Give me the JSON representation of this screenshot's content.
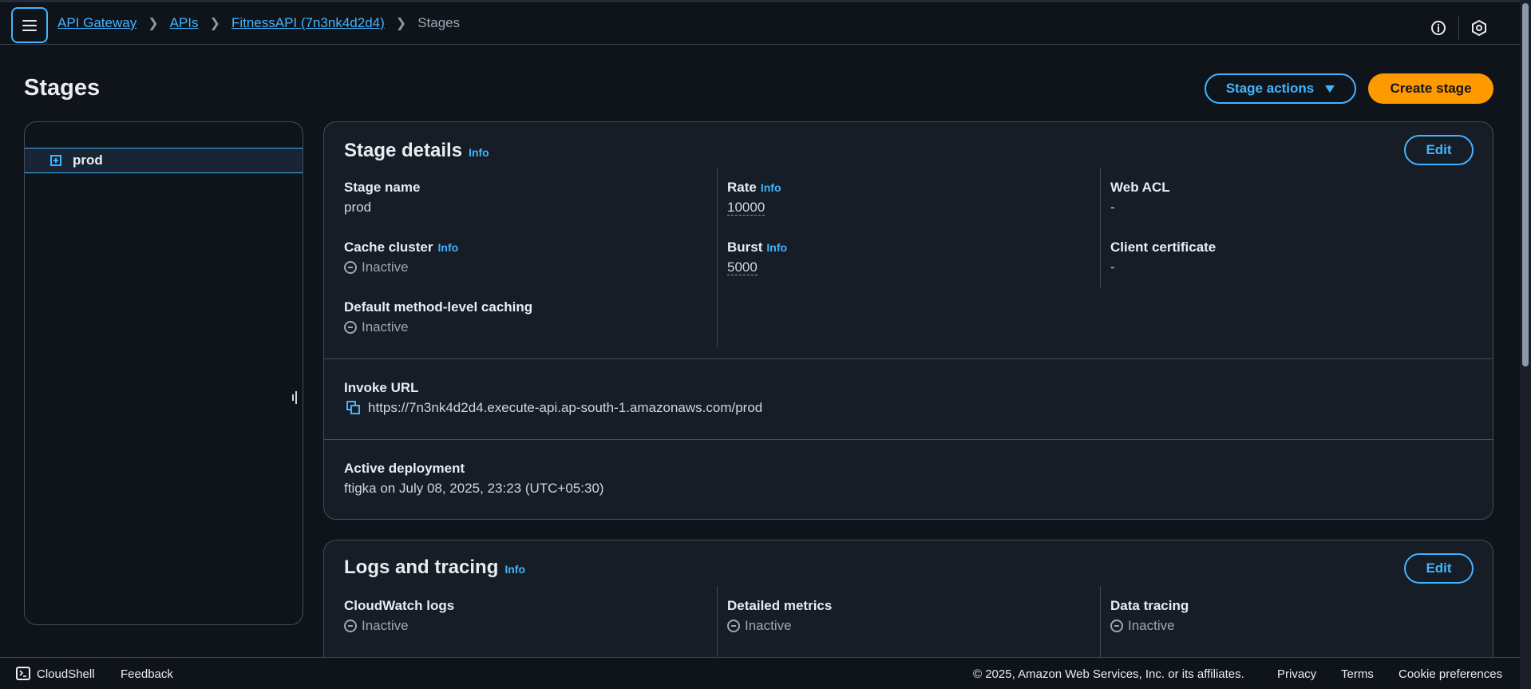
{
  "breadcrumb": {
    "items": [
      "API Gateway",
      "APIs",
      "FitnessAPI (7n3nk4d2d4)"
    ],
    "current": "Stages"
  },
  "page": {
    "title": "Stages",
    "stage_actions_label": "Stage actions",
    "create_stage_label": "Create stage"
  },
  "sidebar": {
    "items": [
      {
        "label": "prod"
      }
    ]
  },
  "stage_details": {
    "title": "Stage details",
    "info": "Info",
    "edit_label": "Edit",
    "stage_name_label": "Stage name",
    "stage_name_value": "prod",
    "cache_cluster_label": "Cache cluster",
    "cache_cluster_value": "Inactive",
    "default_caching_label": "Default method-level caching",
    "default_caching_value": "Inactive",
    "rate_label": "Rate",
    "rate_value": "10000",
    "burst_label": "Burst",
    "burst_value": "5000",
    "web_acl_label": "Web ACL",
    "web_acl_value": "-",
    "client_cert_label": "Client certificate",
    "client_cert_value": "-",
    "invoke_url_label": "Invoke URL",
    "invoke_url_value": "https://7n3nk4d2d4.execute-api.ap-south-1.amazonaws.com/prod",
    "active_deployment_label": "Active deployment",
    "active_deployment_value": "ftigka on July 08, 2025, 23:23 (UTC+05:30)"
  },
  "logs": {
    "title": "Logs and tracing",
    "info": "Info",
    "edit_label": "Edit",
    "cloudwatch_label": "CloudWatch logs",
    "cloudwatch_value": "Inactive",
    "metrics_label": "Detailed metrics",
    "metrics_value": "Inactive",
    "tracing_label": "Data tracing",
    "tracing_value": "Inactive"
  },
  "footer": {
    "cloudshell": "CloudShell",
    "feedback": "Feedback",
    "copyright": "© 2025, Amazon Web Services, Inc. or its affiliates.",
    "privacy": "Privacy",
    "terms": "Terms",
    "cookies": "Cookie preferences"
  },
  "colors": {
    "accent": "#42b4ff",
    "primary_button": "#ff9900",
    "background": "#0f141a",
    "card": "#161d26"
  },
  "icons": [
    "menu-icon",
    "info-circle-icon",
    "settings-hex-icon",
    "expand-plus-icon",
    "caret-down-icon",
    "copy-icon",
    "inactive-status-icon",
    "cloudshell-icon"
  ]
}
